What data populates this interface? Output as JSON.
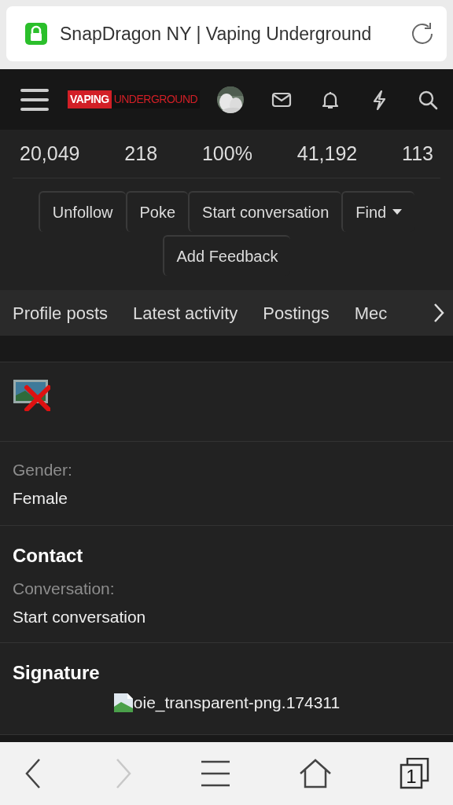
{
  "address_bar": {
    "title": "SnapDragon NY | Vaping Underground",
    "secure": true
  },
  "header": {
    "logo": {
      "left": "VAPING",
      "right": "UNDERGROUND"
    }
  },
  "stats": [
    "20,049",
    "218",
    "100%",
    "41,192",
    "113"
  ],
  "buttons": [
    {
      "label": "Unfollow",
      "kind": "plain"
    },
    {
      "label": "Poke",
      "kind": "plain"
    },
    {
      "label": "Start conversation",
      "kind": "plain"
    },
    {
      "label": "Find",
      "kind": "dropdown"
    },
    {
      "label": "Add Feedback",
      "kind": "plain"
    }
  ],
  "tabs": [
    {
      "label": "Profile posts",
      "selected": false
    },
    {
      "label": "Latest activity",
      "selected": false
    },
    {
      "label": "Postings",
      "selected": false
    },
    {
      "label": "Mec",
      "selected": false
    }
  ],
  "about": {
    "fields": [
      {
        "label": "Gender:",
        "value": "Female"
      }
    ]
  },
  "contact": {
    "title": "Contact",
    "fields": [
      {
        "label": "Conversation:",
        "value": "Start conversation"
      }
    ]
  },
  "signature": {
    "title": "Signature",
    "image_alt": "oie_transparent-png.174311"
  },
  "browser_bar": {
    "back_disabled": false,
    "forward_disabled": true,
    "tab_count": "1"
  }
}
